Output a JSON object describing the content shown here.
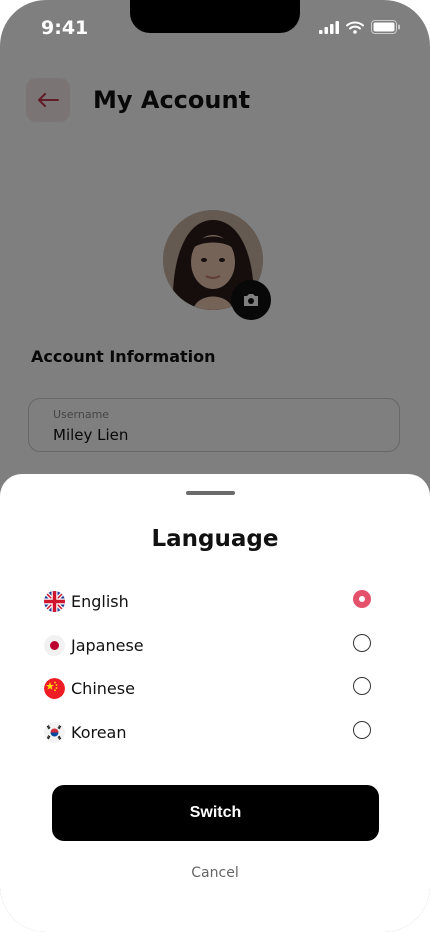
{
  "status_bar": {
    "time": "9:41"
  },
  "header": {
    "title": "My Account"
  },
  "account": {
    "section_title": "Account Information",
    "username_label": "Username",
    "username_value": "Miley Lien"
  },
  "language_sheet": {
    "title": "Language",
    "options": [
      {
        "label": "English",
        "flag": "uk-flag-icon",
        "selected": true
      },
      {
        "label": "Japanese",
        "flag": "japan-flag-icon",
        "selected": false
      },
      {
        "label": "Chinese",
        "flag": "china-flag-icon",
        "selected": false
      },
      {
        "label": "Korean",
        "flag": "korea-flag-icon",
        "selected": false
      }
    ],
    "primary_button": "Switch",
    "secondary_button": "Cancel"
  },
  "colors": {
    "accent": "#e4516b",
    "primary_button_bg": "#000000",
    "overlay": "rgba(0,0,0,0.5)"
  }
}
